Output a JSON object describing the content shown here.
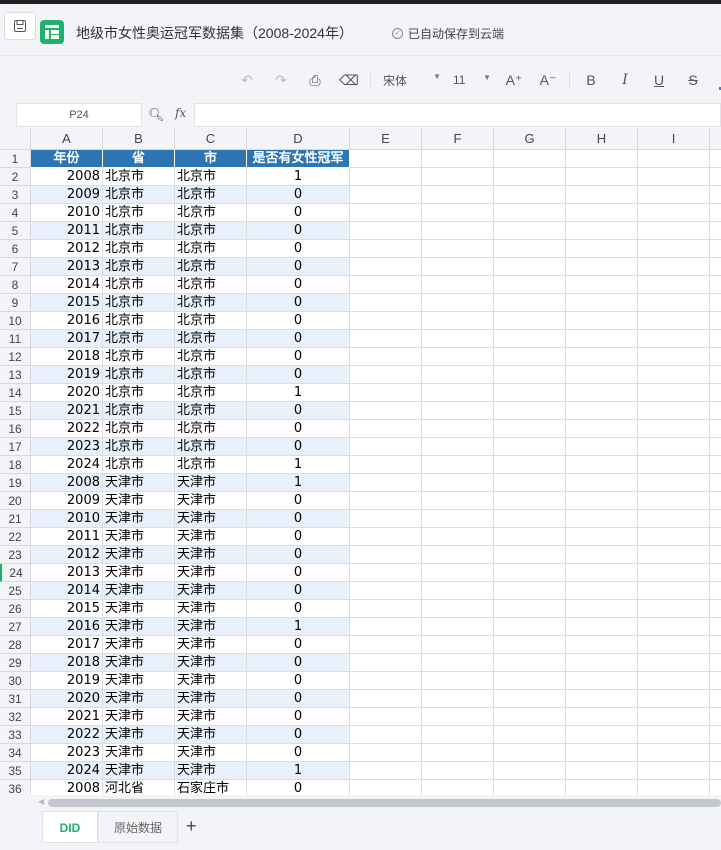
{
  "title_bar": {
    "doc_title": "地级市女性奥运冠军数据集（2008-2024年）",
    "autosave_status": "已自动保存到云端"
  },
  "toolbar": {
    "font_name": "宋体",
    "font_size": "11",
    "bold": "B",
    "italic": "I",
    "underline": "U",
    "strike": "S",
    "font_color": "A",
    "grow": "A⁺",
    "shrink": "A⁻",
    "accent_color": "#3a7bf0"
  },
  "formula_bar": {
    "cell_ref": "P24",
    "fx_label": "fx",
    "formula_value": ""
  },
  "columns": [
    "A",
    "B",
    "C",
    "D",
    "E",
    "F",
    "G",
    "H",
    "I"
  ],
  "headers": [
    "年份",
    "省",
    "市",
    "是否有女性冠军"
  ],
  "rows": [
    [
      "2008",
      "北京市",
      "北京市",
      "1"
    ],
    [
      "2009",
      "北京市",
      "北京市",
      "0"
    ],
    [
      "2010",
      "北京市",
      "北京市",
      "0"
    ],
    [
      "2011",
      "北京市",
      "北京市",
      "0"
    ],
    [
      "2012",
      "北京市",
      "北京市",
      "0"
    ],
    [
      "2013",
      "北京市",
      "北京市",
      "0"
    ],
    [
      "2014",
      "北京市",
      "北京市",
      "0"
    ],
    [
      "2015",
      "北京市",
      "北京市",
      "0"
    ],
    [
      "2016",
      "北京市",
      "北京市",
      "0"
    ],
    [
      "2017",
      "北京市",
      "北京市",
      "0"
    ],
    [
      "2018",
      "北京市",
      "北京市",
      "0"
    ],
    [
      "2019",
      "北京市",
      "北京市",
      "0"
    ],
    [
      "2020",
      "北京市",
      "北京市",
      "1"
    ],
    [
      "2021",
      "北京市",
      "北京市",
      "0"
    ],
    [
      "2022",
      "北京市",
      "北京市",
      "0"
    ],
    [
      "2023",
      "北京市",
      "北京市",
      "0"
    ],
    [
      "2024",
      "北京市",
      "北京市",
      "1"
    ],
    [
      "2008",
      "天津市",
      "天津市",
      "1"
    ],
    [
      "2009",
      "天津市",
      "天津市",
      "0"
    ],
    [
      "2010",
      "天津市",
      "天津市",
      "0"
    ],
    [
      "2011",
      "天津市",
      "天津市",
      "0"
    ],
    [
      "2012",
      "天津市",
      "天津市",
      "0"
    ],
    [
      "2013",
      "天津市",
      "天津市",
      "0"
    ],
    [
      "2014",
      "天津市",
      "天津市",
      "0"
    ],
    [
      "2015",
      "天津市",
      "天津市",
      "0"
    ],
    [
      "2016",
      "天津市",
      "天津市",
      "1"
    ],
    [
      "2017",
      "天津市",
      "天津市",
      "0"
    ],
    [
      "2018",
      "天津市",
      "天津市",
      "0"
    ],
    [
      "2019",
      "天津市",
      "天津市",
      "0"
    ],
    [
      "2020",
      "天津市",
      "天津市",
      "0"
    ],
    [
      "2021",
      "天津市",
      "天津市",
      "0"
    ],
    [
      "2022",
      "天津市",
      "天津市",
      "0"
    ],
    [
      "2023",
      "天津市",
      "天津市",
      "0"
    ],
    [
      "2024",
      "天津市",
      "天津市",
      "1"
    ],
    [
      "2008",
      "河北省",
      "石家庄市",
      "0"
    ]
  ],
  "selected_row": 24,
  "sheet_tabs": [
    {
      "label": "DID",
      "active": true
    },
    {
      "label": "原始数据",
      "active": false
    }
  ],
  "add_sheet": "+"
}
